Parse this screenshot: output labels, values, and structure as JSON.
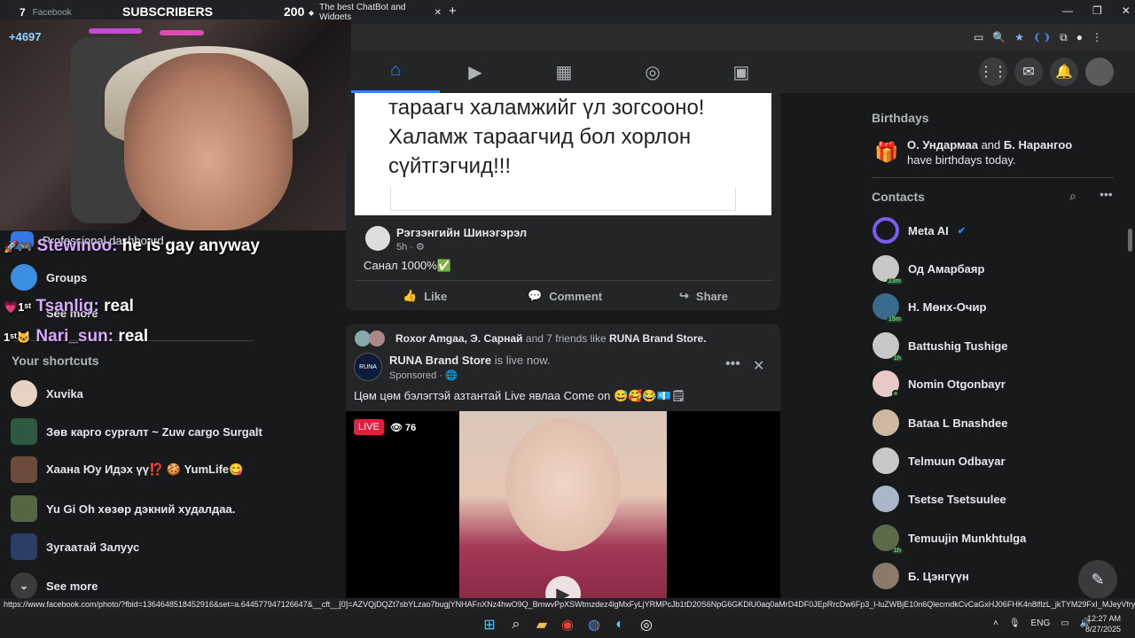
{
  "browser": {
    "tabs": [
      {
        "label": "Facebook",
        "count": "7"
      },
      {
        "label": "The best ChatBot and Widgets"
      }
    ],
    "overlay_subscribers_label": "SUBSCRIBERS",
    "overlay_subscribers_value": "200",
    "overlay_streak": "+4697",
    "new_tab_label": "+"
  },
  "stream_chat": [
    {
      "name": "Stewinoo:",
      "msg": "he is gay anyway"
    },
    {
      "name": "Tsanlig:",
      "msg": "real"
    },
    {
      "name": "Nari_sun:",
      "msg": "real"
    }
  ],
  "sidebar": {
    "items": [
      {
        "label": "Professional dashboard",
        "icon": "dashboard-icon"
      },
      {
        "label": "Groups",
        "icon": "groups-icon"
      },
      {
        "label": "See more",
        "icon": "chevron-down-icon"
      }
    ],
    "shortcuts_heading": "Your shortcuts",
    "shortcuts": [
      {
        "label": "Xuvika"
      },
      {
        "label": "Зөв карго сургалт ~ Zuw cargo Surgalt"
      },
      {
        "label": "Хаана Юу Идэх үү⁉️ 🍪 YumLife😋"
      },
      {
        "label": "Yu Gi Oh хөзөр дэкний худалдаа."
      },
      {
        "label": "Зугаатай Залуус"
      }
    ],
    "see_more": "See more"
  },
  "post_a": {
    "image_text_line1": "тараагч халамжийг үл зогсооно!",
    "image_text_line2": "Халамж тараагчид бол хорлон",
    "image_text_line3": "сүйтгэгчид!!!",
    "author": "Рэгзэнгийн Шинэгэрэл",
    "time": "5h",
    "body": "Санал 1000%✅",
    "actions": {
      "like": "Like",
      "comment": "Comment",
      "share": "Share"
    }
  },
  "post_b": {
    "friends_like_names": "Roxor Amgaa, Э. Сарнай",
    "friends_like_rest": "and 7 friends like",
    "friends_like_page": "RUNA Brand Store.",
    "page_name": "RUNA Brand Store",
    "live_text": "is live now.",
    "sponsored": "Sponsored",
    "body": "Цөм цөм бэлэгтэй азтантай Live явлаа Come on 😅🥰😂💶🗒",
    "live_badge": "LIVE",
    "viewers": "76"
  },
  "right_rail": {
    "birthdays_heading": "Birthdays",
    "birthday_name1": "О. Ундармаа",
    "birthday_and": "and",
    "birthday_name2": "Б. Нарангоо",
    "birthday_rest": "have birthdays today.",
    "contacts_heading": "Contacts",
    "contacts": [
      {
        "name": "Meta AI",
        "badge": ""
      },
      {
        "name": "Од Амарбаяр",
        "badge": "23m"
      },
      {
        "name": "Н. Мөнх-Очир",
        "badge": "15m"
      },
      {
        "name": "Battushig Tushige",
        "badge": "1h"
      },
      {
        "name": "Nomin Otgonbayr",
        "badge": ""
      },
      {
        "name": "Bataa L Bnashdee",
        "badge": ""
      },
      {
        "name": "Telmuun Odbayar",
        "badge": ""
      },
      {
        "name": "Tsetse Tsetsuulee",
        "badge": ""
      },
      {
        "name": "Temuujin Munkhtulga",
        "badge": "1h"
      },
      {
        "name": "Б. Цэнгүүн",
        "badge": ""
      }
    ]
  },
  "status_url": "https://www.facebook.com/photo/?fbid=1364648518452916&set=a.644577947126647&__cft__[0]=AZVQjDQZt7sbYLzao7bugjYNHAFnXNz4hwO9Q_BmwvPpXSWtmzdez4lgMxFyLjYRMPcJb1tD20S6NpG6GKDlU0aq0aMrD4DF0JEpRrcDw6Fp3_l-luZWBjE10n6QlecmdkCvCaGxHJ06FHK4n8lflzL_jkTYM29FxI_MJeyVfrykGrx6W_C4FBIR_T5wLUVW4OxWv76HiOrc...",
  "taskbar": {
    "lang": "ENG",
    "time": "12:27 AM",
    "date": "8/27/2025"
  },
  "colors": {
    "accent": "#2d88ff",
    "bg": "#18191a",
    "card": "#242526",
    "live": "#e41e3f"
  }
}
